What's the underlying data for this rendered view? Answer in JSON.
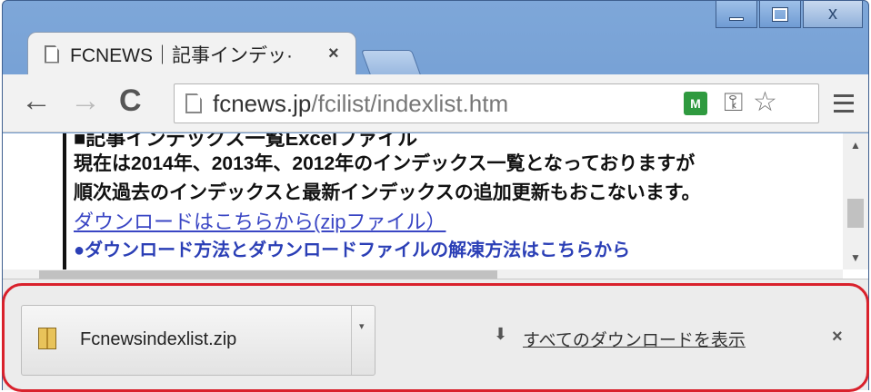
{
  "window": {
    "minimize_glyph": "minimize-icon",
    "maximize_glyph": "maximize-icon",
    "close_label": "x"
  },
  "tab": {
    "title": "FCNEWS｜記事インデッ·",
    "close_label": "×"
  },
  "toolbar": {
    "back_label": "←",
    "forward_label": "→",
    "reload_label": "C",
    "url_host": "fcnews.jp",
    "url_path": "/fcilist/indexlist.htm",
    "extension_label": "M",
    "key_label": "⚿",
    "star_label": "☆"
  },
  "content": {
    "heading": "■記事インデックス一覧Excelファイル",
    "line1": "現在は2014年、2013年、2012年のインデックス一覧となっておりますが",
    "line2": "順次過去のインデックスと最新インデックスの追加更新もおこないます。",
    "download_link": "ダウンロードはこちらから(zipファイル）",
    "howto_link": "●ダウンロード方法とダウンロードファイルの解凍方法はこちらから"
  },
  "download_shelf": {
    "file_name": "Fcnewsindexlist.zip",
    "dropdown_label": "▾",
    "show_all_icon": "⬇",
    "show_all_label": "すべてのダウンロードを表示",
    "close_label": "×"
  },
  "colors": {
    "frame": "#6f9bd3",
    "link": "#3a46c4",
    "highlight": "#d9212c"
  }
}
